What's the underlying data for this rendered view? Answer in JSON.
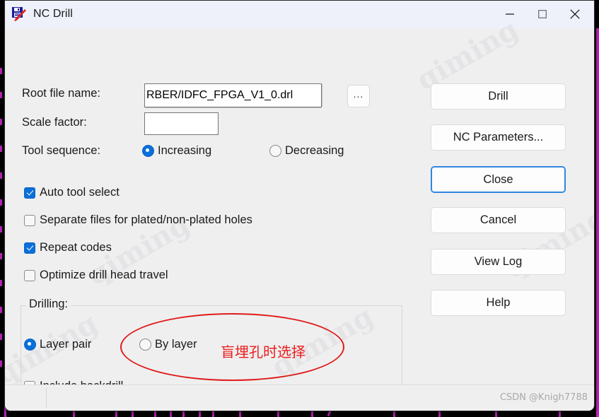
{
  "window": {
    "title": "NC Drill",
    "icon": "nc-drill-app-icon",
    "controls": {
      "minimize": "minimize-icon",
      "maximize": "maximize-icon",
      "close": "close-icon"
    }
  },
  "form": {
    "root_file_label": "Root file name:",
    "root_file_value": "RBER/IDFC_FPGA_V1_0.drl",
    "browse_label": "...",
    "scale_factor_label": "Scale factor:",
    "scale_factor_value": "",
    "tool_sequence_label": "Tool sequence:",
    "tool_sequence_options": [
      {
        "label": "Increasing",
        "selected": true
      },
      {
        "label": "Decreasing",
        "selected": false
      }
    ]
  },
  "options": [
    {
      "label": "Auto tool select",
      "checked": true
    },
    {
      "label": "Separate files for plated/non-plated holes",
      "checked": false
    },
    {
      "label": "Repeat codes",
      "checked": true
    },
    {
      "label": "Optimize drill head travel",
      "checked": false
    }
  ],
  "drilling": {
    "legend": "Drilling:",
    "mode_options": [
      {
        "label": "Layer pair",
        "selected": true
      },
      {
        "label": "By layer",
        "selected": false
      }
    ],
    "include_backdrill": {
      "label": "Include backdrill",
      "checked": false
    }
  },
  "buttons": [
    {
      "label": "Drill",
      "focused": false
    },
    {
      "label": "NC Parameters...",
      "focused": false
    },
    {
      "label": "Close",
      "focused": true
    },
    {
      "label": "Cancel",
      "focused": false
    },
    {
      "label": "View Log",
      "focused": false
    },
    {
      "label": "Help",
      "focused": false
    }
  ],
  "annotation": {
    "text": "盲埋孔时选择",
    "color": "#ee1c1c",
    "shape": "ellipse"
  },
  "status_bar": {
    "watermark": "CSDN @Knigh7788"
  },
  "page_watermarks": [
    "qiming",
    "qiming",
    "qiming",
    "qiming",
    "qiming"
  ],
  "colors": {
    "title_bar": "#eef1fa",
    "dialog_face": "#efefef",
    "accent": "#0a6fd8",
    "focus_ring": "#2f86e0",
    "annotation_red": "#ee1c1c",
    "backdrop": "#000000",
    "pcb_trace": "#c423c4"
  }
}
